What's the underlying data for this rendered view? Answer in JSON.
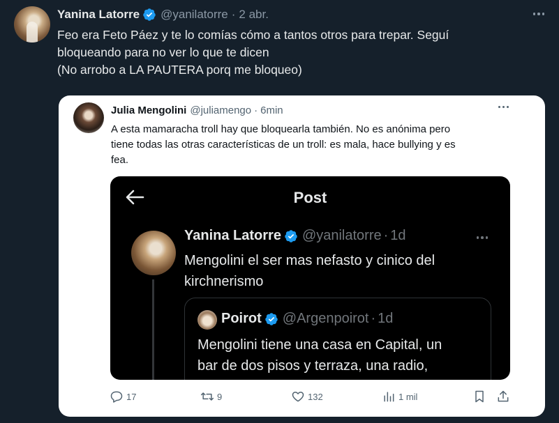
{
  "tweet": {
    "name": "Yanina Latorre",
    "handle": "@yanilatorre",
    "separator": "·",
    "date": "2 abr.",
    "text_lines": [
      "Feo era Feto Páez y te lo comías cómo a tantos otros para trepar. Seguí",
      "bloqueando para no ver lo que te dicen",
      "(No arrobo a LA PAUTERA porq me bloqueo)"
    ]
  },
  "quote": {
    "name": "Julia Mengolini",
    "handle": "@juliamengo",
    "separator": "·",
    "date": "6min",
    "text_lines": [
      "A esta mamaracha troll hay que bloquearla también. No es anónima pero",
      "tiene todas las otras características de un troll: es mala, hace bullying y es",
      "fea."
    ],
    "screenshot": {
      "title": "Post",
      "name": "Yanina Latorre",
      "handle": "@yanilatorre",
      "separator": "·",
      "date": "1d",
      "text_lines": [
        "Mengolini el ser mas nefasto y cinico del",
        "kirchnerismo"
      ],
      "inner_quote": {
        "name": "Poirot",
        "handle": "@Argenpoirot",
        "separator": "·",
        "date": "1d",
        "text_lines": [
          "Mengolini tiene una casa en Capital, un",
          "bar de dos pisos y terraza, una radio,"
        ]
      }
    },
    "actions": {
      "replies": "17",
      "retweets": "9",
      "likes": "132",
      "views": "1 mil"
    }
  },
  "colors": {
    "background": "#15202b",
    "verified": "#1d9bf0",
    "muted": "#8b98a5"
  },
  "icons": [
    "verified-badge-icon",
    "more-icon",
    "back-arrow-icon",
    "reply-icon",
    "retweet-icon",
    "like-icon",
    "views-icon",
    "bookmark-icon",
    "share-icon"
  ]
}
